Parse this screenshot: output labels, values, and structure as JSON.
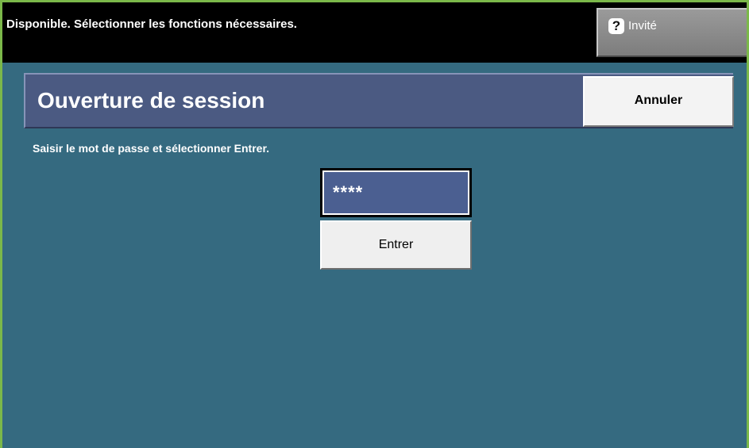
{
  "status_bar": {
    "message": "Disponible.  Sélectionner les fonctions nécessaires.",
    "guest_button": {
      "icon": "help-icon",
      "icon_glyph": "?",
      "label": "Invité"
    }
  },
  "header": {
    "title": "Ouverture de session",
    "cancel_label": "Annuler"
  },
  "main": {
    "instruction": "Saisir le mot de passe et sélectionner Entrer.",
    "password_value": "****",
    "enter_label": "Entrer"
  },
  "colors": {
    "background": "#356a80",
    "title_panel": "#4b5a82",
    "password_field": "#4b5f91",
    "accent_border": "#7bb84a"
  }
}
